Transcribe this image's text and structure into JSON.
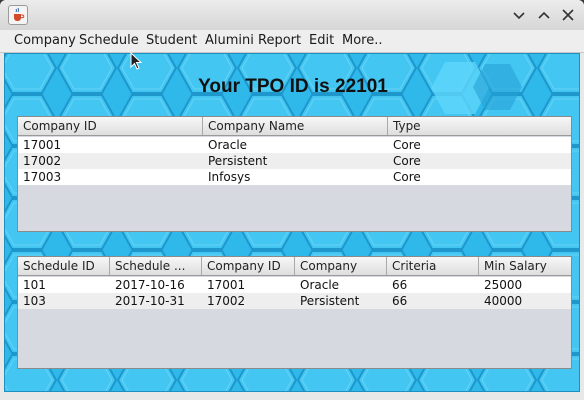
{
  "window": {
    "icon": "java-cup-icon",
    "controls": [
      "minimize",
      "maximize",
      "close"
    ]
  },
  "menubar": {
    "items": [
      "Company",
      "Schedule",
      "Student",
      "Alumini",
      "Report",
      "Edit",
      "More.."
    ]
  },
  "main": {
    "title": "Your TPO ID is 22101"
  },
  "companies_table": {
    "columns": [
      "Company ID",
      "Company Name",
      "Type"
    ],
    "rows": [
      [
        "17001",
        "Oracle",
        "Core"
      ],
      [
        "17002",
        "Persistent",
        "Core"
      ],
      [
        "17003",
        "Infosys",
        "Core"
      ]
    ]
  },
  "schedule_table": {
    "columns": [
      "Schedule ID",
      "Schedule ...",
      "Company ID",
      "Company",
      "Criteria",
      "Min Salary"
    ],
    "rows": [
      [
        "101",
        "2017-10-16",
        "17001",
        "Oracle",
        "66",
        "25000"
      ],
      [
        "103",
        "2017-10-31",
        "17002",
        "Persistent",
        "66",
        "40000"
      ]
    ]
  },
  "colors": {
    "background": "#2fb8ea",
    "row_even": "#ffffff",
    "row_odd": "#eeeeee",
    "empty_area": "#d7d9e0"
  }
}
